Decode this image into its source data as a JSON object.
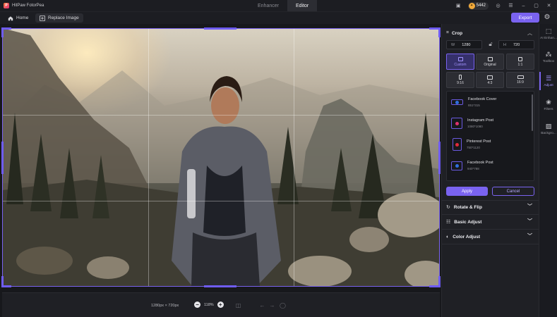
{
  "app": {
    "name": "HitPaw FotorPea",
    "logo_letter": "P"
  },
  "mode_tabs": [
    {
      "label": "Enhancer",
      "active": false
    },
    {
      "label": "Editor",
      "active": true
    }
  ],
  "header": {
    "credits": "5442",
    "credit_icon": "coin-icon"
  },
  "toolbar": {
    "home_label": "Home",
    "replace_label": "Replace Image",
    "export_label": "Export"
  },
  "canvas": {
    "dimensions_text": "1280px × 720px",
    "zoom_text": "118%"
  },
  "crop": {
    "title": "Crop",
    "width_label": "W",
    "width_value": "1280",
    "height_label": "H",
    "height_value": "720",
    "ratios": [
      {
        "label": "Custom",
        "active": true
      },
      {
        "label": "Original",
        "active": false
      },
      {
        "label": "1:1",
        "active": false
      },
      {
        "label": "9:16",
        "active": false
      },
      {
        "label": "4:3",
        "active": false
      },
      {
        "label": "16:9",
        "active": false
      }
    ],
    "presets": [
      {
        "title": "Facebook Cover",
        "size": "851*315",
        "color": "#2f6fe0"
      },
      {
        "title": "Instagram Post",
        "size": "1080*1080",
        "color": "#e0316f"
      },
      {
        "title": "Pinterest Post",
        "size": "750*1120",
        "color": "#e02a3a"
      },
      {
        "title": "Facebook Post",
        "size": "940*788",
        "color": "#2f6fe0"
      }
    ],
    "apply_label": "Apply",
    "cancel_label": "Cancel"
  },
  "sections": [
    {
      "label": "Rotate & Flip",
      "icon": "rotate-icon"
    },
    {
      "label": "Basic Adjust",
      "icon": "sliders-icon"
    },
    {
      "label": "Color Adjust",
      "icon": "palette-icon"
    }
  ],
  "rail": [
    {
      "label": "AI Enhan...",
      "icon": "ai-enhance-icon",
      "active": false
    },
    {
      "label": "Toolbox",
      "icon": "toolbox-icon",
      "active": false
    },
    {
      "label": "Adjust",
      "icon": "adjust-icon",
      "active": true
    },
    {
      "label": "Filters",
      "icon": "filters-icon",
      "active": false
    },
    {
      "label": "Backgro...",
      "icon": "background-icon",
      "active": false
    }
  ],
  "colors": {
    "accent": "#7a63f0",
    "panel_bg": "#1f2025",
    "app_bg": "#17181c"
  }
}
